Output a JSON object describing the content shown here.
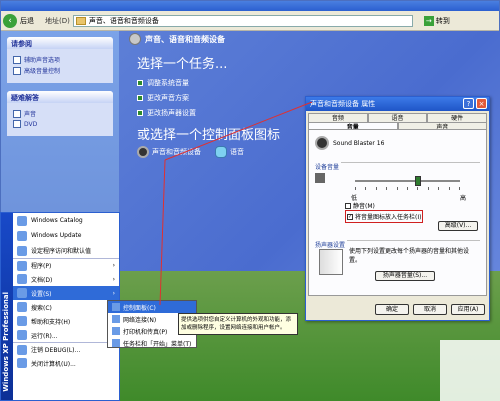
{
  "address": {
    "back_label": "后退",
    "label": "地址(D)",
    "value": "声音、语音和音频设备",
    "go": "转到"
  },
  "sidebar": {
    "see_also": {
      "title": "请参阅",
      "items": [
        "辅助声音选项",
        "高级音量控制"
      ]
    },
    "troubleshoot": {
      "title": "疑难解答",
      "items": [
        "声音",
        "DVD"
      ]
    }
  },
  "main": {
    "title": "声音、语音和音频设备",
    "task_heading": "选择一个任务...",
    "tasks": [
      "调整系统音量",
      "更改声音方案",
      "更改扬声器设置"
    ],
    "cp_heading": "或选择一个控制面板图标",
    "icons": [
      "声音和音频设备",
      "语音"
    ]
  },
  "dialog": {
    "title": "声音和音频设备 属性",
    "help": "?",
    "close": "×",
    "tabs_top": [
      "音频",
      "语音",
      "硬件"
    ],
    "tabs_bottom": [
      "音量",
      "声音"
    ],
    "device": "Sound Blaster 16",
    "volume_group": "设备音量",
    "low": "低",
    "high": "高",
    "volume_level_pct": 55,
    "mute": "静音(M)",
    "taskbar": "将音量图标放入任务栏(I)",
    "advanced": "高级(V)...",
    "speaker_group": "扬声器设置",
    "speaker_text": "使用下列设置更改每个扬声器的音量和其他设置。",
    "speaker_button": "扬声器音量(S)...",
    "advanced2": "高级(D)...",
    "ok": "确定",
    "cancel": "取消",
    "apply": "应用(A)"
  },
  "start_menu": {
    "band": "Windows XP Professional",
    "pinned": [
      "Windows Catalog",
      "Windows Update",
      "设定程序访问和默认值"
    ],
    "items": [
      {
        "label": "程序(P)",
        "chev": "›"
      },
      {
        "label": "文档(D)",
        "chev": "›"
      },
      {
        "label": "设置(S)",
        "chev": "›"
      },
      {
        "label": "搜索(C)",
        "chev": "›"
      },
      {
        "label": "帮助和支持(H)",
        "chev": ""
      },
      {
        "label": "运行(R)...",
        "chev": ""
      },
      {
        "label": "注销 DEBUG(L)...",
        "chev": ""
      },
      {
        "label": "关闭计算机(U)...",
        "chev": ""
      }
    ]
  },
  "submenu": {
    "items": [
      "控制面板(C)",
      "网络连接(N)",
      "打印机和传真(P)",
      "任务栏和「开始」菜单(T)"
    ]
  },
  "tooltip": "提供选项供您自定义计算机的外观和功能，添加或删除程序，设置网络连接和用户帐户。"
}
